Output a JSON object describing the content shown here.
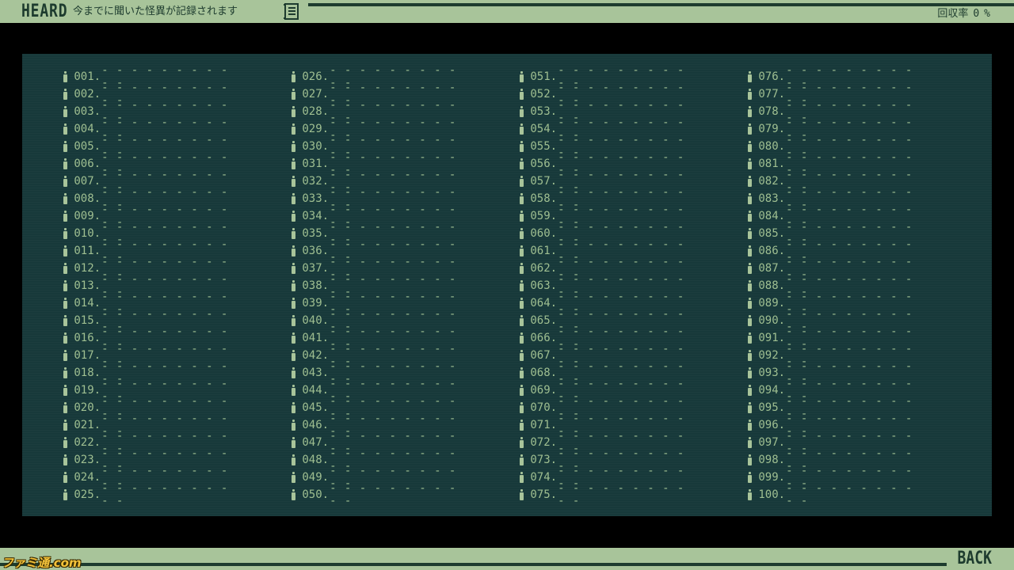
{
  "header": {
    "title": "HEARD",
    "subtitle": "今までに聞いた怪異が記録されます",
    "list_icon": "list-document-icon",
    "rate_label": "回収率",
    "rate_value": "0",
    "rate_unit": "%"
  },
  "entries": {
    "placeholder": "- - - - - - - - - - -",
    "icon": "microphone-icon",
    "columns": [
      [
        "001.",
        "002.",
        "003.",
        "004.",
        "005.",
        "006.",
        "007.",
        "008.",
        "009.",
        "010.",
        "011.",
        "012.",
        "013.",
        "014.",
        "015.",
        "016.",
        "017.",
        "018.",
        "019.",
        "020.",
        "021.",
        "022.",
        "023.",
        "024.",
        "025."
      ],
      [
        "026.",
        "027.",
        "028.",
        "029.",
        "030.",
        "031.",
        "032.",
        "033.",
        "034.",
        "035.",
        "036.",
        "037.",
        "038.",
        "039.",
        "040.",
        "041.",
        "042.",
        "043.",
        "044.",
        "045.",
        "046.",
        "047.",
        "048.",
        "049.",
        "050."
      ],
      [
        "051.",
        "052.",
        "053.",
        "054.",
        "055.",
        "056.",
        "057.",
        "058.",
        "059.",
        "060.",
        "061.",
        "062.",
        "063.",
        "064.",
        "065.",
        "066.",
        "067.",
        "068.",
        "069.",
        "070.",
        "071.",
        "072.",
        "073.",
        "074.",
        "075."
      ],
      [
        "076.",
        "077.",
        "078.",
        "079.",
        "080.",
        "081.",
        "082.",
        "083.",
        "084.",
        "085.",
        "086.",
        "087.",
        "088.",
        "089.",
        "090.",
        "091.",
        "092.",
        "093.",
        "094.",
        "095.",
        "096.",
        "097.",
        "098.",
        "099.",
        "100."
      ]
    ]
  },
  "footer": {
    "back_label": "BACK",
    "watermark": "ファミ通.com"
  },
  "colors": {
    "bar": "#a8c49a",
    "bar_text": "#1d3b2e",
    "panel": "#17393a",
    "entry_text": "#9fbf91",
    "background": "#000000"
  }
}
